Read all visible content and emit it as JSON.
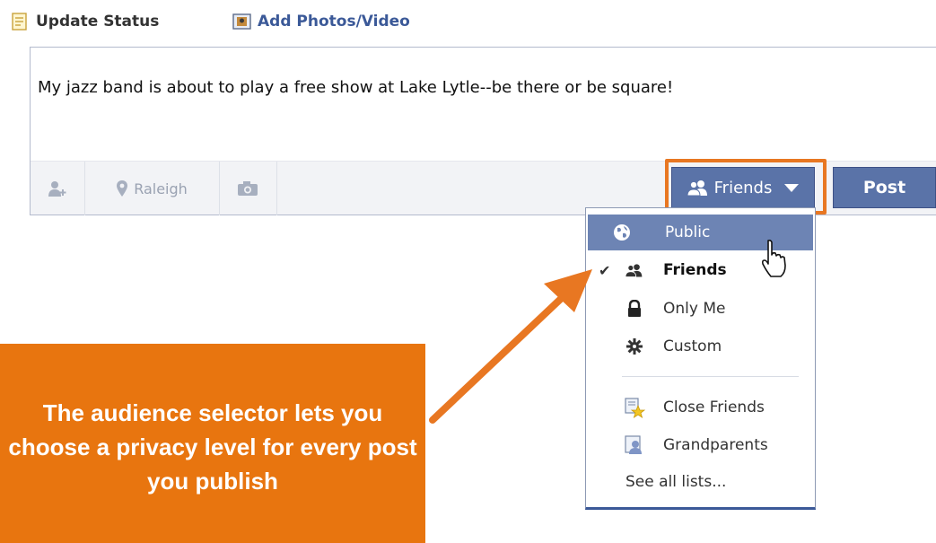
{
  "composer": {
    "tabs": [
      {
        "label": "Update Status",
        "icon": "document-icon"
      },
      {
        "label": "Add Photos/Video",
        "icon": "photo-icon"
      }
    ],
    "status_text": "My jazz band is about to play a free show at Lake Lytle--be there or be square!",
    "location": "Raleigh"
  },
  "audience": {
    "selected": "Friends",
    "post_label": "Post",
    "menu_items": [
      {
        "label": "Public",
        "icon": "globe-icon",
        "hovered": true
      },
      {
        "label": "Friends",
        "icon": "friends-icon",
        "checked": true
      },
      {
        "label": "Only Me",
        "icon": "lock-icon"
      },
      {
        "label": "Custom",
        "icon": "gear-icon"
      }
    ],
    "list_items": [
      {
        "label": "Close Friends",
        "icon": "star-list-icon"
      },
      {
        "label": "Grandparents",
        "icon": "person-list-icon"
      }
    ],
    "see_all": "See all lists..."
  },
  "callout": {
    "text": "The audience selector lets you choose a privacy level for every post you publish"
  },
  "colors": {
    "accent_orange": "#e87722",
    "facebook_blue": "#5a73a8",
    "link_blue": "#3b5998"
  }
}
